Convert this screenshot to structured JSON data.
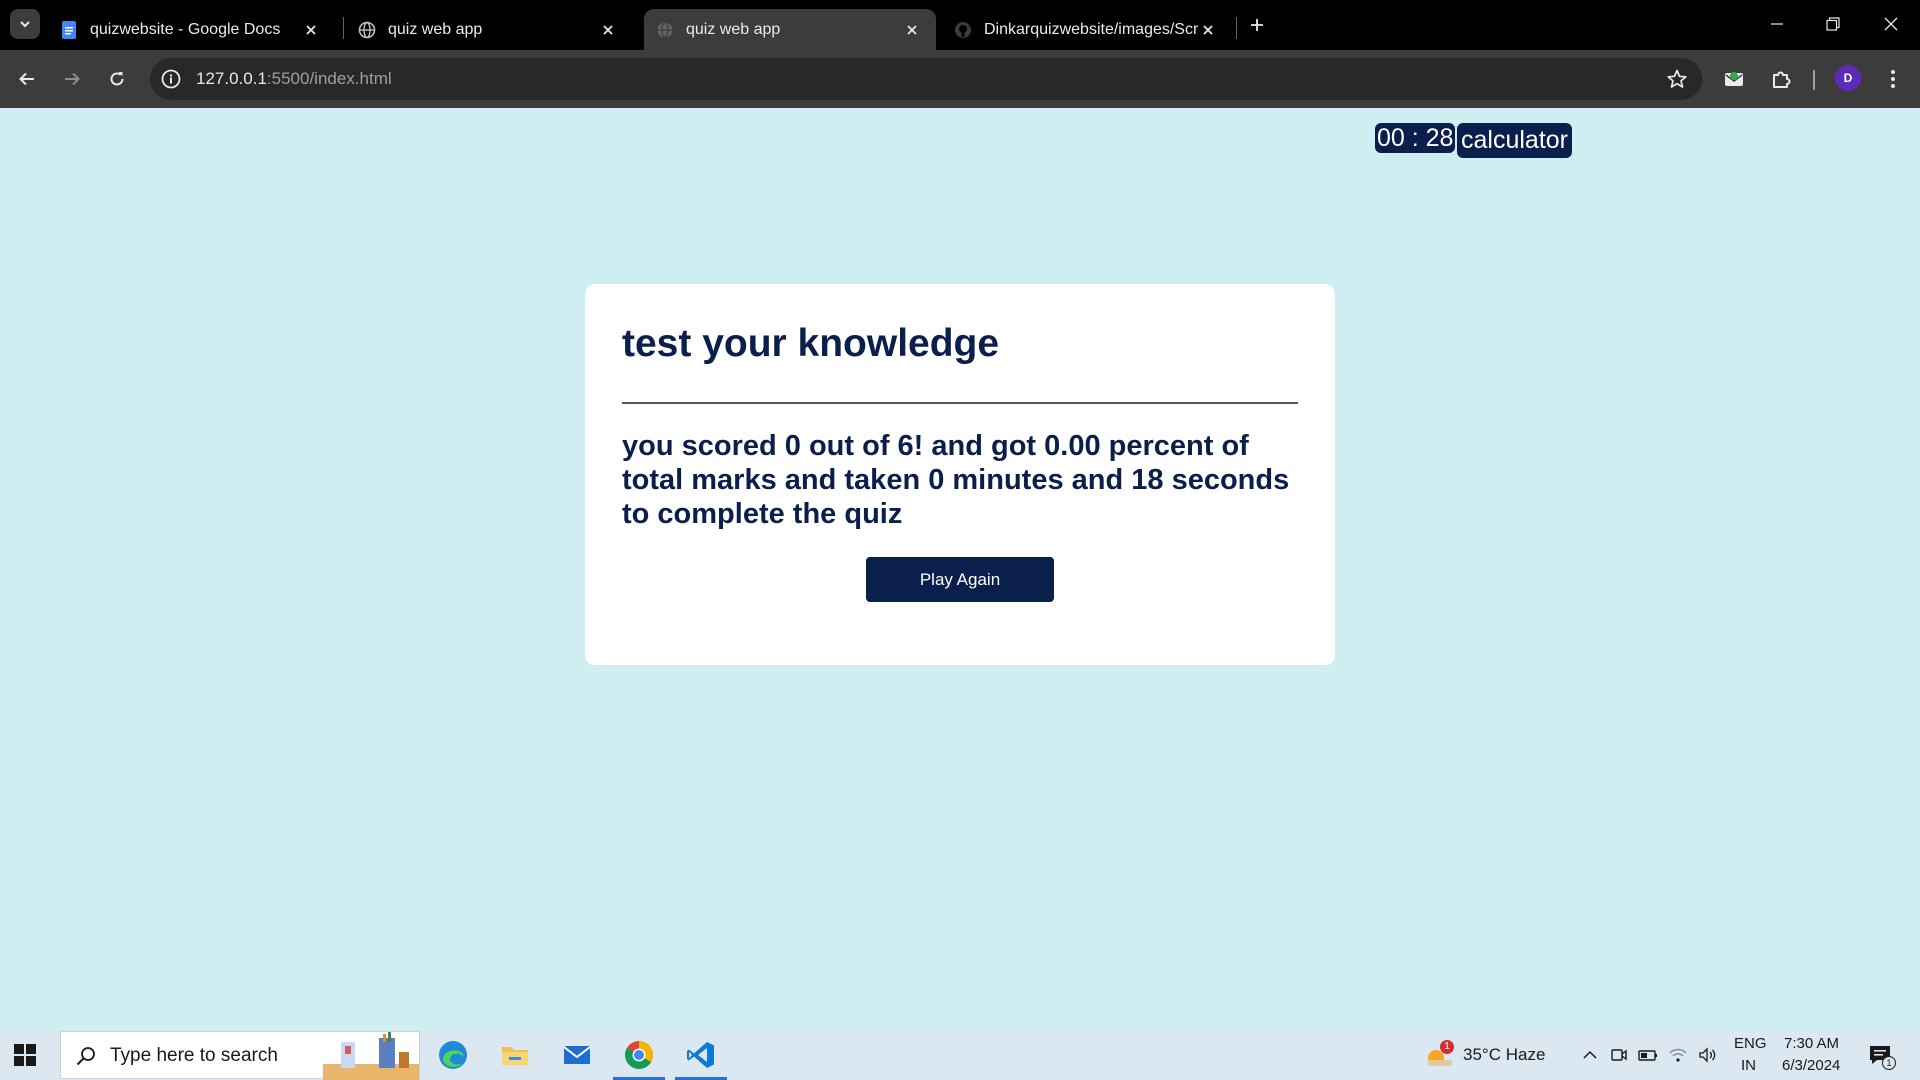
{
  "browser": {
    "tabs": [
      {
        "title": "quizwebsite - Google Docs",
        "favicon": "google-docs-icon",
        "active": false
      },
      {
        "title": "quiz web app",
        "favicon": "globe-icon",
        "active": false
      },
      {
        "title": "quiz web app",
        "favicon": "globe-icon",
        "active": true
      },
      {
        "title": "Dinkarquizwebsite/images/Scre",
        "favicon": "github-icon",
        "active": false
      }
    ],
    "url_host": "127.0.0.1",
    "url_rest": ":5500/index.html",
    "profile_initial": "D"
  },
  "page": {
    "timer": "00 : 28",
    "calculator_label": "calculator",
    "heading": "test your knowledge",
    "result_text": "you scored 0 out of 6! and got 0.00 percent of total marks and taken 0 minutes and 18 seconds to complete the quiz",
    "play_again_label": "Play Again"
  },
  "taskbar": {
    "search_placeholder": "Type here to search",
    "weather": "35°C  Haze",
    "weather_badge": "1",
    "lang_top": "ENG",
    "lang_bottom": "IN",
    "time": "7:30 AM",
    "date": "6/3/2024",
    "notifications_count": "1"
  },
  "colors": {
    "page_bg": "#cfeef1",
    "navy": "#0b1f4d",
    "taskbar_bg": "#dbe7f1"
  }
}
